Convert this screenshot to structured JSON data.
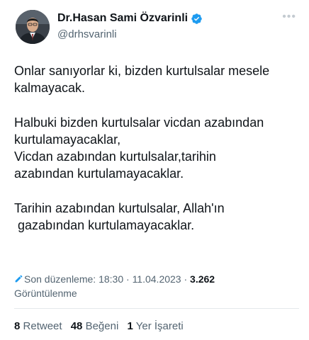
{
  "user": {
    "display_name": "Dr.Hasan Sami Özvarinli",
    "handle": "@drhsvarinli"
  },
  "tweet": {
    "text": "Onlar sanıyorlar ki, bizden kurtulsalar mesele\nkalmayacak.\n\nHalbuki bizden kurtulsalar vicdan azabından\nkurtulamayacaklar,\nVicdan azabından kurtulsalar,tarihin\nazabından kurtulamayacaklar.\n\nTarihin azabından kurtulsalar, Allah'ın\n gazabından kurtulamayacaklar."
  },
  "meta": {
    "edited_label": "Son düzenleme: 18:30",
    "separator1": " · ",
    "date": "11.04.2023",
    "separator2": " · ",
    "views_count": "3.262",
    "views_label": "Görüntülenme"
  },
  "stats": {
    "retweets_count": "8",
    "retweets_label": "Retweet",
    "likes_count": "48",
    "likes_label": "Beğeni",
    "bookmarks_count": "1",
    "bookmarks_label": "Yer İşareti"
  },
  "icons": {
    "verified": "verified-badge-icon",
    "more": "more-options-icon",
    "edit": "pencil-edit-icon"
  },
  "colors": {
    "accent": "#1d9bf0",
    "text_primary": "#0f1419",
    "text_secondary": "#536471",
    "divider": "#e4e8eb"
  }
}
